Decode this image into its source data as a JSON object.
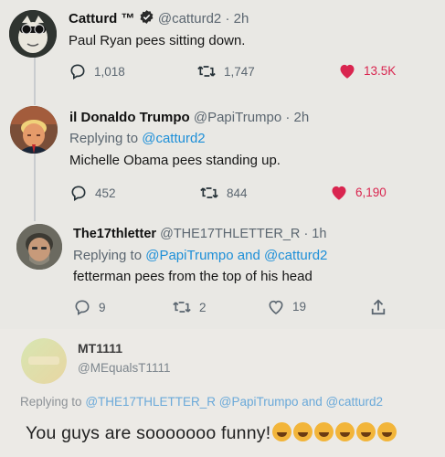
{
  "colors": {
    "like": "#d9254f",
    "link": "#1d8fd8",
    "muted": "#5b6670"
  },
  "tweets": [
    {
      "name": "Catturd ™",
      "verified": true,
      "handle": "@catturd2",
      "time": "· 2h",
      "text": "Paul Ryan pees sitting down.",
      "replies": "1,018",
      "retweets": "1,747",
      "likes": "13.5K",
      "liked": true
    },
    {
      "name": "il Donaldo Trumpo",
      "handle": "@PapiTrumpo",
      "time": "· 2h",
      "replying_prefix": "Replying to",
      "replying_to": "@catturd2",
      "text": "Michelle Obama pees standing up.",
      "replies": "452",
      "retweets": "844",
      "likes": "6,190",
      "liked": true
    },
    {
      "name": "The17thletter",
      "handle": "@THE17THLETTER_R",
      "time": "· 1h",
      "replying_prefix": "Replying to",
      "replying_to": "@PapiTrumpo and @catturd2",
      "text": "fetterman pees from the top of his head",
      "replies": "9",
      "retweets": "2",
      "likes": "19",
      "liked": false
    },
    {
      "name": "MT1111",
      "handle": "@MEqualsT1111",
      "replying_prefix": "Replying to",
      "replying_to": "@THE17THLETTER_R @PapiTrumpo and @catturd2",
      "text": "You guys are sooooooo funny!"
    }
  ],
  "icons": {
    "reply": "reply-icon",
    "retweet": "retweet-icon",
    "like": "heart-icon",
    "share": "share-icon",
    "verified": "verified-badge-icon",
    "emoji": "laughing-emoji-icon"
  }
}
